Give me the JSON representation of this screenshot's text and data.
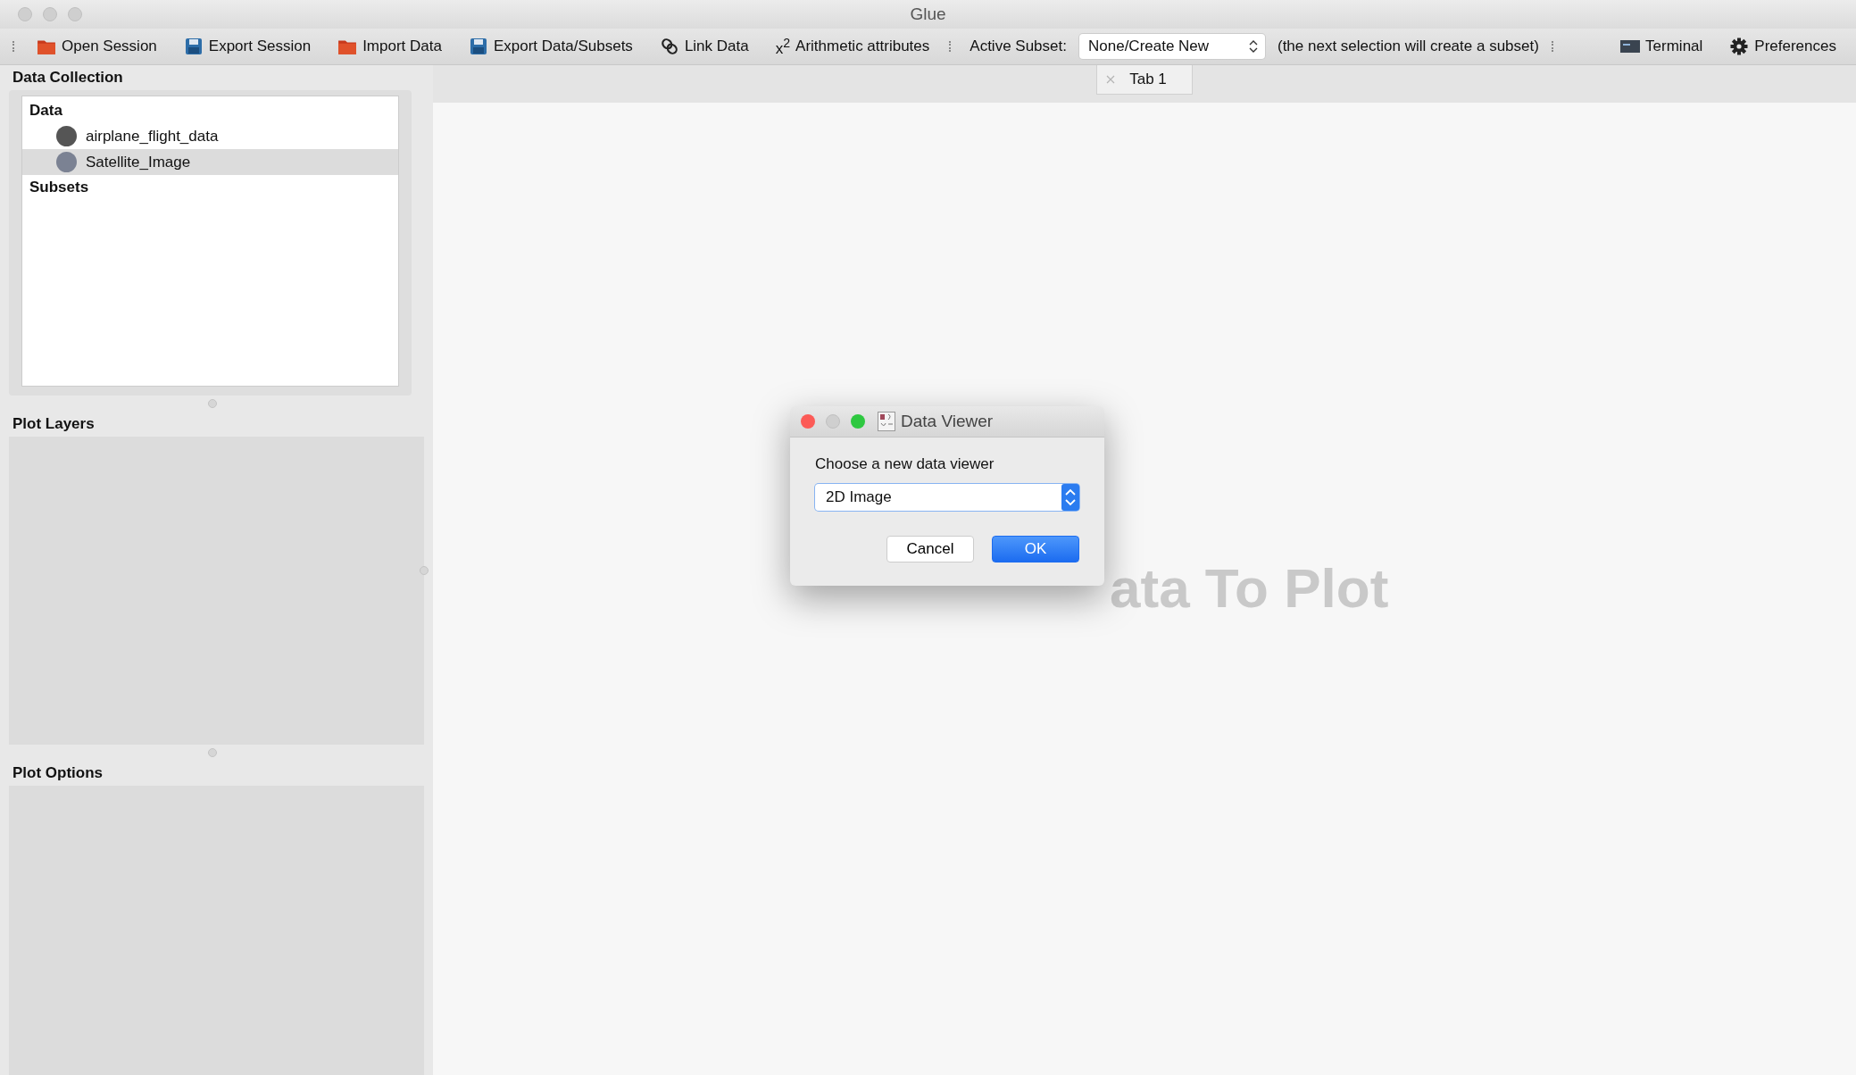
{
  "window": {
    "title": "Glue"
  },
  "toolbar": {
    "items": [
      {
        "kind": "folder",
        "label": "Open Session"
      },
      {
        "kind": "disk",
        "label": "Export Session"
      },
      {
        "kind": "folder",
        "label": "Import Data"
      },
      {
        "kind": "disk",
        "label": "Export Data/Subsets"
      },
      {
        "kind": "link",
        "label": "Link Data"
      },
      {
        "kind": "symbol",
        "symbol": "x$^{2}$",
        "label": "Arithmetic attributes"
      }
    ],
    "active_subset": {
      "label": "Active Subset:",
      "value": "None/Create New",
      "hint": "(the next selection will create a subset)"
    },
    "right_items": [
      {
        "kind": "terminal",
        "label": "Terminal"
      },
      {
        "kind": "gear",
        "label": "Preferences"
      }
    ]
  },
  "data_collection": {
    "title": "Data Collection",
    "groups": [
      {
        "label": "Data",
        "children": [
          {
            "label": "airplane_flight_data",
            "color": "#555555",
            "selected": false
          },
          {
            "label": "Satellite_Image",
            "color": "#7b8293",
            "selected": true
          }
        ]
      },
      {
        "label": "Subsets"
      }
    ]
  },
  "plot_layers": {
    "title": "Plot Layers"
  },
  "plot_options": {
    "title": "Plot Options"
  },
  "tabs": [
    {
      "label": "Tab 1",
      "selected": true
    }
  ],
  "canvas": {
    "hint": "ata To Plot"
  },
  "dialog": {
    "title": "Data Viewer",
    "prompt": "Choose a new data viewer",
    "viewer": "2D Image",
    "buttons": [
      {
        "label": "Cancel",
        "kind": "secondary"
      },
      {
        "label": "OK",
        "kind": "primary"
      }
    ]
  }
}
